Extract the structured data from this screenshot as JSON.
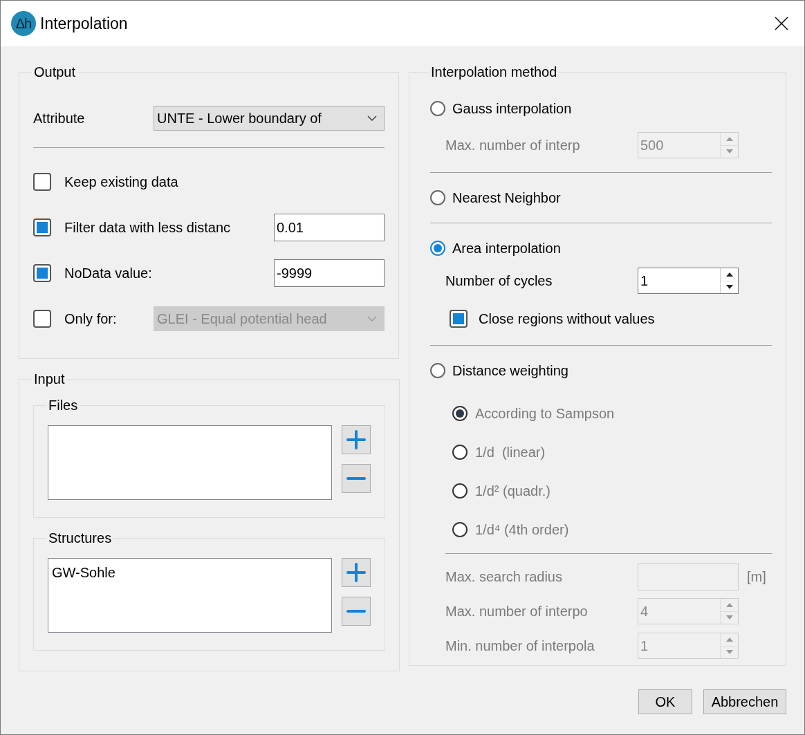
{
  "window": {
    "title": "Interpolation",
    "icon_text": "Δh"
  },
  "output": {
    "title": "Output",
    "attribute": {
      "label": "Attribute",
      "value": "UNTE - Lower boundary of"
    },
    "options": [
      {
        "kind": "plain",
        "label": "Keep existing data",
        "checked": false
      },
      {
        "kind": "field",
        "label": "Filter data with less distanc",
        "checked": true,
        "value": "0.01"
      },
      {
        "kind": "field",
        "label": "NoData value:",
        "checked": true,
        "value": "-9999"
      },
      {
        "kind": "dropdown",
        "label": "Only for:",
        "checked": false,
        "value": "GLEI - Equal potential head",
        "disabled": true
      }
    ]
  },
  "input": {
    "title": "Input",
    "lists": [
      {
        "title": "Files"
      },
      {
        "title": "Structures",
        "items": [
          "GW-Sohle"
        ]
      }
    ]
  },
  "method": {
    "title": "Interpolation method",
    "methods": [
      {
        "label": "Gauss interpolation",
        "selected": false,
        "settings": [
          {
            "kind": "spin",
            "label": "Max. number of interp",
            "value": "500",
            "disabled": true
          }
        ]
      },
      {
        "label": "Nearest Neighbor",
        "selected": false
      },
      {
        "label": "Area interpolation",
        "selected": true,
        "settings": [
          {
            "kind": "spin",
            "label": "Number of cycles",
            "value": "1",
            "disabled": false
          },
          {
            "kind": "checkbox",
            "label": "Close regions without values",
            "checked": true,
            "disabled": false
          }
        ]
      },
      {
        "label": "Distance weighting",
        "selected": false,
        "weightings": [
          {
            "label": "According to Sampson",
            "selected": true,
            "disabled": true
          },
          {
            "label": "1/d  (linear)",
            "selected": false,
            "disabled": true
          },
          {
            "label": "1/d² (quadr.)",
            "selected": false,
            "disabled": true
          },
          {
            "label": "1/d⁴ (4th order)",
            "selected": false,
            "disabled": true
          }
        ],
        "settings": [
          {
            "kind": "text",
            "label": "Max. search radius",
            "unit": "[m]",
            "disabled": true
          },
          {
            "kind": "spin",
            "label": "Max. number of interpo",
            "value": "4",
            "disabled": true
          },
          {
            "kind": "spin",
            "label": "Min. number of interpola",
            "value": "1",
            "disabled": true
          }
        ]
      }
    ]
  },
  "buttons": [
    "OK",
    "Abbrechen"
  ]
}
